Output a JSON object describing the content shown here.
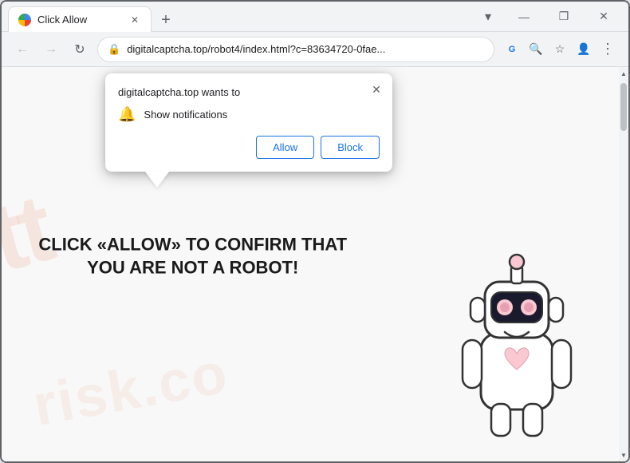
{
  "browser": {
    "tab": {
      "title": "Click Allow",
      "favicon_alt": "browser-favicon"
    },
    "new_tab_label": "+",
    "window_controls": {
      "minimize": "—",
      "maximize": "❐",
      "close": "✕"
    },
    "address_bar": {
      "url": "digitalcaptcha.top/robot4/index.html?c=83634720-0fae...",
      "lock_icon": "🔒",
      "back_icon": "←",
      "forward_icon": "→",
      "refresh_icon": "↻"
    },
    "toolbar_icons": {
      "translate": "G",
      "search": "🔍",
      "bookmark": "☆",
      "profile": "👤",
      "menu": "⋮"
    }
  },
  "notification_popup": {
    "title": "digitalcaptcha.top wants to",
    "permission": "Show notifications",
    "allow_button": "Allow",
    "block_button": "Block",
    "close_icon": "✕"
  },
  "page": {
    "main_text": "CLICK «ALLOW» TO CONFIRM THAT YOU ARE NOT A ROBOT!",
    "watermark_line1": "ptt",
    "watermark_line2": "risk.co"
  }
}
